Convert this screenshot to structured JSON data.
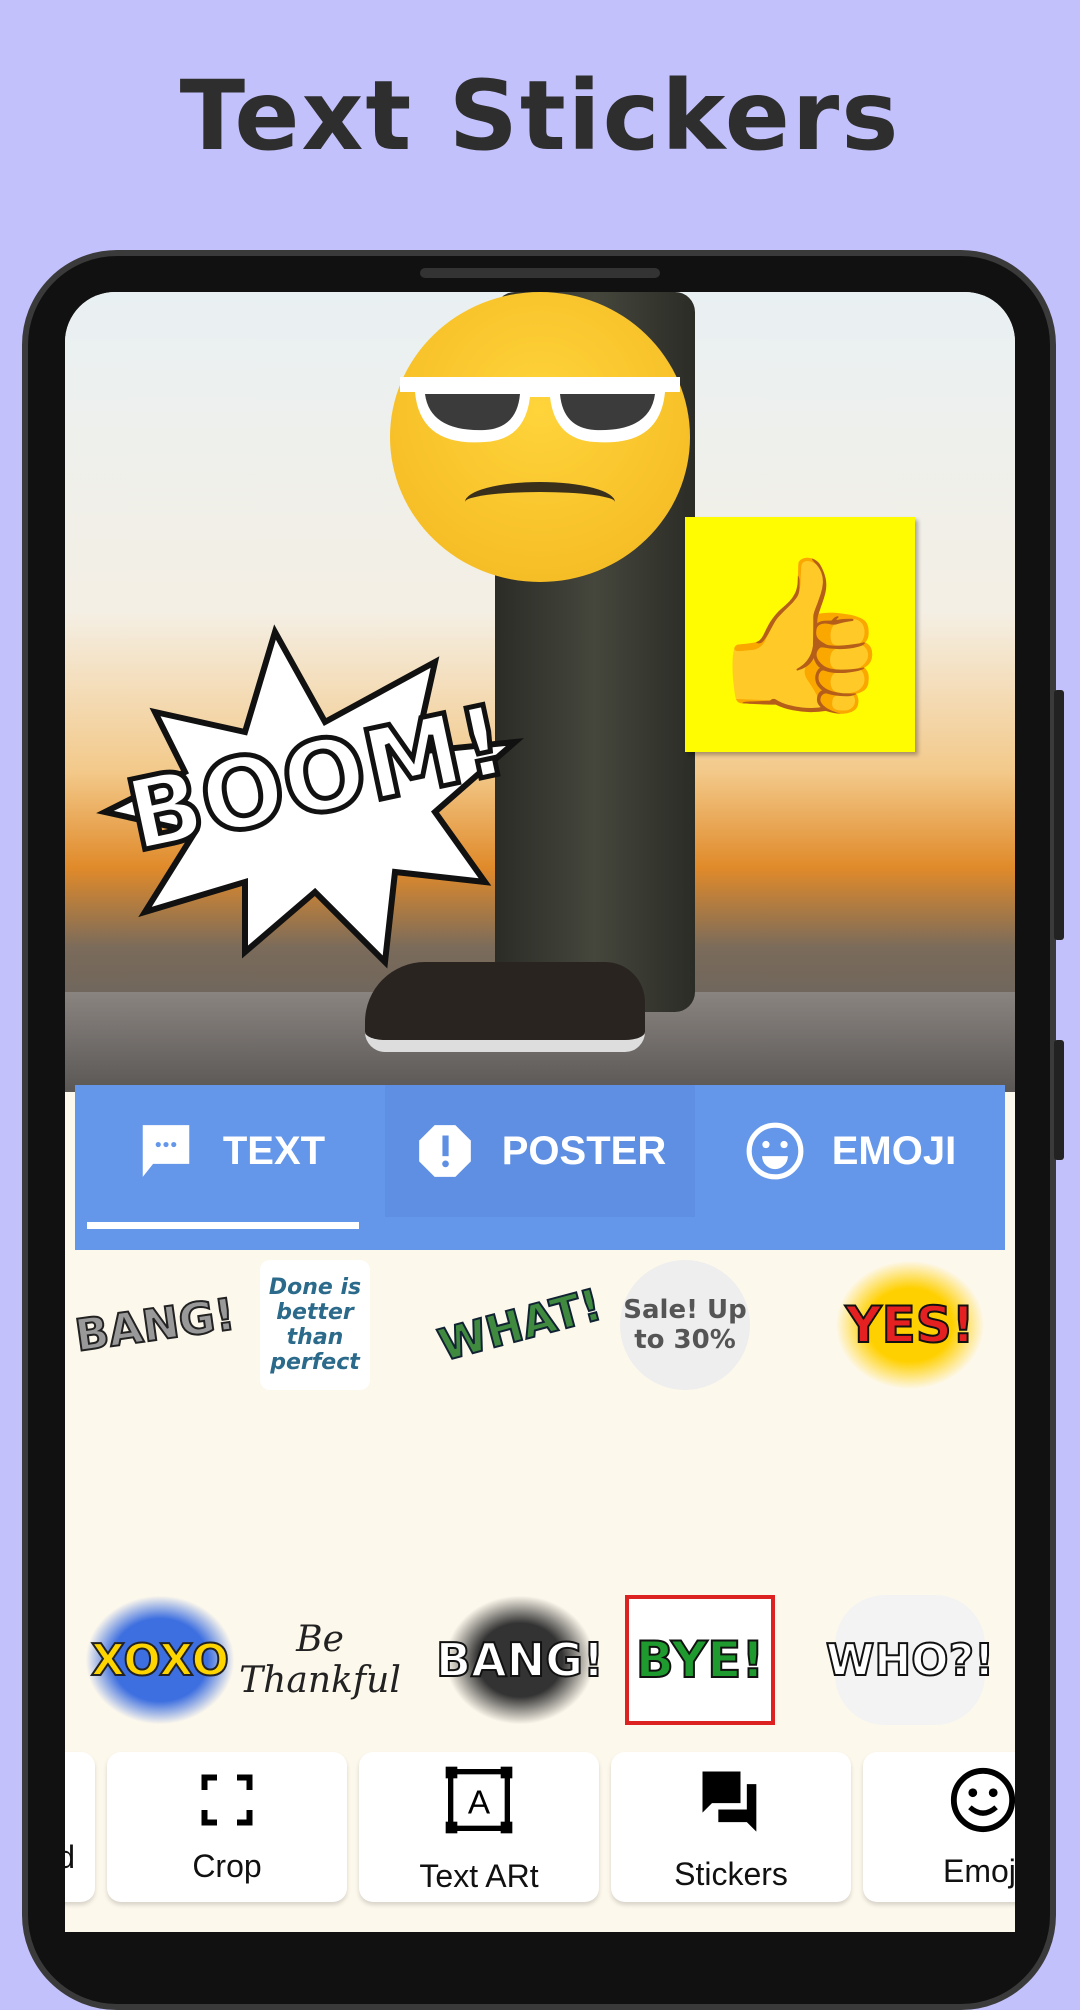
{
  "header": {
    "title": "Text Stickers"
  },
  "canvas": {
    "stickers": [
      "cool-emoji",
      "BOOM!",
      "thumbs-up-note"
    ]
  },
  "tabs": [
    {
      "label": "TEXT",
      "icon": "message-icon",
      "selected": true
    },
    {
      "label": "POSTER",
      "icon": "alert-octagon-icon"
    },
    {
      "label": "EMOJI",
      "icon": "smiley-icon"
    }
  ],
  "stickers": [
    "BANG!",
    "Done is better than perfect",
    "WHAT!",
    "Sale! Up to 30%",
    "YES!",
    "XOXO",
    "Be Thankful",
    "BANG!",
    "BYE!",
    "WHO?!"
  ],
  "toolbar": [
    {
      "label": "d"
    },
    {
      "label": "Crop",
      "icon": "crop-icon"
    },
    {
      "label": "Text ARt",
      "icon": "text-art-icon"
    },
    {
      "label": "Stickers",
      "icon": "stickers-icon"
    },
    {
      "label": "Emoji",
      "icon": "emoji-icon"
    }
  ],
  "colors": {
    "background": "#c3c1fb",
    "tab_bar": "#6497ea",
    "panel": "#fdf8ec"
  }
}
